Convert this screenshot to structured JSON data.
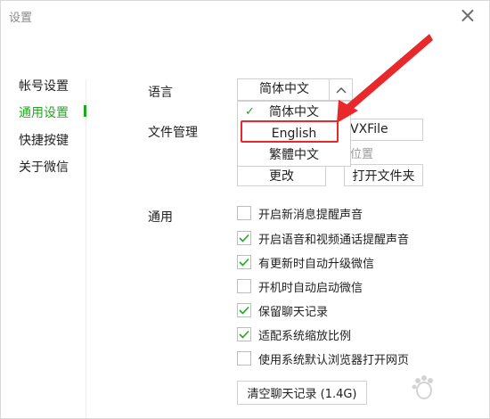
{
  "window": {
    "title": "设置",
    "close_symbol": "×"
  },
  "sidebar": {
    "items": [
      {
        "label": "帐号设置",
        "active": false
      },
      {
        "label": "通用设置",
        "active": true
      },
      {
        "label": "快捷按键",
        "active": false
      },
      {
        "label": "关于微信",
        "active": false
      }
    ]
  },
  "language": {
    "label": "语言",
    "selected": "简体中文",
    "options": [
      {
        "label": "简体中文",
        "checked": true
      },
      {
        "label": "English",
        "checked": false
      },
      {
        "label": "繁體中文",
        "checked": false
      }
    ]
  },
  "file_management": {
    "label": "文件管理",
    "path_visible_fragment": "VXFile",
    "hint_fragment": "位置",
    "change_button": "更改",
    "open_folder_button": "打开文件夹"
  },
  "general": {
    "label": "通用",
    "options": [
      {
        "label": "开启新消息提醒声音",
        "checked": false
      },
      {
        "label": "开启语音和视频通话提醒声音",
        "checked": true
      },
      {
        "label": "有更新时自动升级微信",
        "checked": true
      },
      {
        "label": "开机时自动启动微信",
        "checked": false
      },
      {
        "label": "保留聊天记录",
        "checked": true
      },
      {
        "label": "适配系统缩放比例",
        "checked": true
      },
      {
        "label": "使用系统默认浏览器打开网页",
        "checked": false
      }
    ],
    "clear_history_button": "清空聊天记录 (1.4G)"
  },
  "colors": {
    "accent": "#1aad19",
    "annotation": "#e8282b"
  }
}
